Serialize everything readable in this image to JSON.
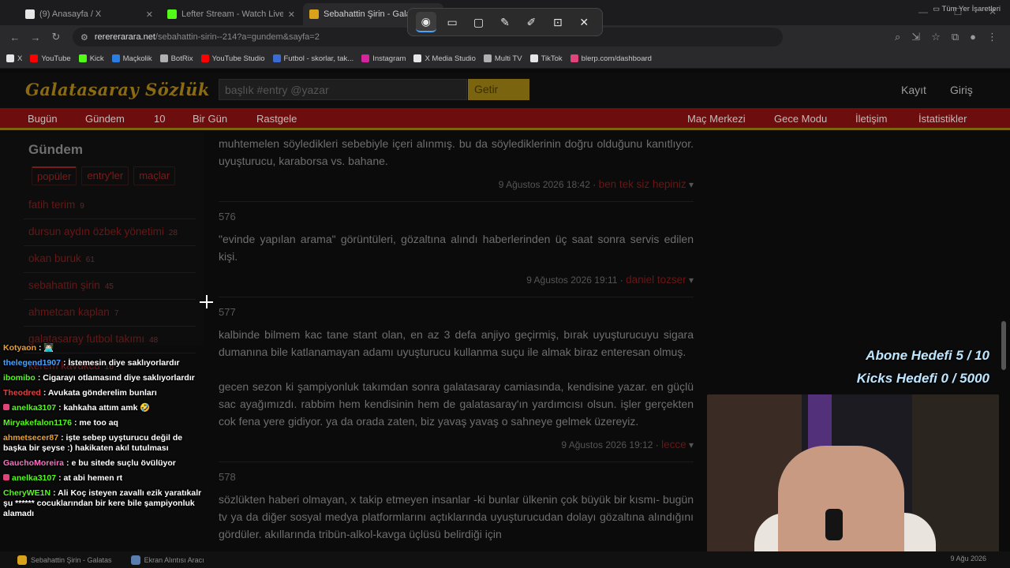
{
  "tabs": [
    {
      "title": "(9) Anasayfa / X",
      "icon": "x-logo-icon",
      "color": "#e6e6e6"
    },
    {
      "title": "Lefter Stream - Watch Live on Kick",
      "icon": "kick-icon",
      "color": "#53fc18"
    },
    {
      "title": "Sebahattin Şirin - Galatasaray Sözlük",
      "icon": "galatasaray-icon",
      "color": "#d9a21b"
    }
  ],
  "snip_toolbar": {
    "icons": [
      "camera-icon",
      "video-icon",
      "rectangle-mode-icon",
      "edit-icon",
      "pen-icon",
      "text-extract-icon",
      "close-icon"
    ]
  },
  "address": {
    "host": "rerererarara.net",
    "path": "/sebahattin-sirin--214?a=gundem&sayfa=2"
  },
  "bookmarks": [
    {
      "label": "X",
      "color": "#e6e6e6"
    },
    {
      "label": "YouTube",
      "color": "#ff0000"
    },
    {
      "label": "Kick",
      "color": "#53fc18"
    },
    {
      "label": "Maçkolik",
      "color": "#2a7de1"
    },
    {
      "label": "BotRix",
      "color": "#b0b0b0"
    },
    {
      "label": "YouTube Studio",
      "color": "#ff0000"
    },
    {
      "label": "Futbol - skorlar, tak...",
      "color": "#3b6cd6"
    },
    {
      "label": "Instagram",
      "color": "#d6249f"
    },
    {
      "label": "X Media Studio",
      "color": "#e6e6e6"
    },
    {
      "label": "Multi TV",
      "color": "#b0b0b0"
    },
    {
      "label": "TikTok",
      "color": "#e6e6e6"
    },
    {
      "label": "blerp.com/dashboard",
      "color": "#e0447a"
    }
  ],
  "bookmarks_right": "Tüm Yer İşaretleri",
  "site": {
    "logo": "Galatasaray Sözlük",
    "search_placeholder": "başlık #entry @yazar",
    "search_button": "Getir",
    "register": "Kayıt",
    "login": "Giriş"
  },
  "nav_left": [
    "Bugün",
    "Gündem",
    "10",
    "Bir Gün",
    "Rastgele"
  ],
  "nav_right": [
    "Maç Merkezi",
    "Gece Modu",
    "İletişim",
    "İstatistikler"
  ],
  "sidebar": {
    "title": "Gündem",
    "tabs": [
      "popüler",
      "entry'ler",
      "maçlar"
    ],
    "items": [
      {
        "label": "fatih terim",
        "count": "9"
      },
      {
        "label": "dursun aydın özbek yönetimi",
        "count": "28"
      },
      {
        "label": "okan buruk",
        "count": "61"
      },
      {
        "label": "sebahattin şirin",
        "count": "45"
      },
      {
        "label": "ahmetcan kaplan",
        "count": "7"
      },
      {
        "label": "galatasaray futbol takımı",
        "count": "48"
      },
      {
        "label": "kerem kavukcu",
        "count": "16"
      }
    ]
  },
  "entries": [
    {
      "number": "",
      "paragraphs": [
        "muhtemelen söyledikleri sebebiyle içeri alınmış. bu da söylediklerinin doğru olduğunu kanıtlıyor. uyuşturucu, karaborsa vs. bahane."
      ],
      "date": "9 Ağustos 2026 18:42",
      "author": "ben tek siz hepiniz"
    },
    {
      "number": "576",
      "paragraphs": [
        "\"evinde yapılan arama\" görüntüleri, gözaltına alındı haberlerinden üç saat sonra servis edilen kişi."
      ],
      "date": "9 Ağustos 2026 19:11",
      "author": "daniel tozser"
    },
    {
      "number": "577",
      "paragraphs": [
        "kalbinde bilmem kac tane stant olan, en az 3 defa anjiyo geçirmiş, bırak uyuşturucuyu sigara dumanına bile katlanamayan adamı uyuşturucu kullanma suçu ile almak biraz enteresan olmuş.",
        "gecen sezon ki şampiyonluk takımdan sonra galatasaray camiasında, kendisine yazar. en güçlü sac ayağımızdı. rabbim hem kendisinin hem de galatasaray'ın yardımcısı olsun. işler gerçekten cok fena yere gidiyor. ya da orada zaten, biz yavaş yavaş o sahneye gelmek üzereyiz."
      ],
      "date": "9 Ağustos 2026 19:12",
      "author": "lecce"
    },
    {
      "number": "578",
      "paragraphs": [
        "sözlükten haberi olmayan, x takip etmeyen insanlar -ki bunlar ülkenin çok büyük bir kısmı- bugün tv ya da diğer sosyal medya platformlarını açtıklarında uyuşturucudan dolayı gözaltına alındığını gördüler. akıllarında tribün-alkol-kavga üçlüsü belirdiği için"
      ],
      "date": "",
      "author": ""
    }
  ],
  "stream_goals": {
    "line1": "Abone Hedefi 5 / 10",
    "line2": "Kicks Hedefi 0 / 5000"
  },
  "chat": [
    {
      "user": "Kotyaon",
      "color": "#f0a030",
      "text": ": 👨🏻‍💻"
    },
    {
      "user": "thelegend1907",
      "color": "#4aa3ff",
      "text": ": İstemesin diye saklıyorlardır"
    },
    {
      "user": "ibomibo",
      "color": "#53fc18",
      "text": ": Cigarayı otlamasınd diye saklıyorlardır"
    },
    {
      "user": "Theodred",
      "color": "#e04040",
      "text": ": Avukata gönderelim bunları"
    },
    {
      "user": "anelka3107",
      "color": "#53fc18",
      "text": ": kahkaha attım amk 🤣"
    },
    {
      "user": "Miryakefalon1176",
      "color": "#53fc18",
      "text": ": me too aq"
    },
    {
      "user": "ahmetsecer87",
      "color": "#f0a030",
      "text": ": işte sebep uyşturucu değil de başka bir şeyse :) hakikaten akıl tutulması"
    },
    {
      "user": "GauchoMoreira",
      "color": "#ff6ec7",
      "text": ": e bu sitede suçlu övülüyor"
    },
    {
      "user": "anelka3107",
      "color": "#53fc18",
      "text": ": at abi hemen rt"
    },
    {
      "user": "CheryWE1N",
      "color": "#53fc18",
      "text": ": Ali Koç isteyen zavallı ezik yaratıkalr şu ****** cocuklarından bir kere bile şampiyonluk alamadı"
    }
  ],
  "taskbar": {
    "items": [
      "Sebahattin Şirin - Galatas",
      "Ekran Alıntısı Aracı"
    ],
    "date": "9 Ağu 2026"
  }
}
